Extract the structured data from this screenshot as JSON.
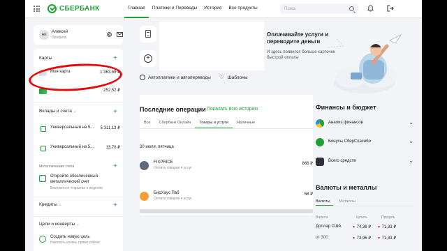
{
  "header": {
    "logo_text": "СБЕРБАНК",
    "nav": [
      "Главная",
      "Платежи и Переводы",
      "История",
      "Все продукты"
    ],
    "search_placeholder": "Поиск"
  },
  "profile": {
    "initials": "АК",
    "name": "Алексей",
    "subtitle": "Профиль"
  },
  "left": {
    "cards_head": "Карты",
    "cards": [
      {
        "label": "Моя карта",
        "sub": "··",
        "amount": "1 363,69 ₽"
      },
      {
        "label": "",
        "amount": "252,52 ₽"
      }
    ],
    "deposits_head": "Вклады и счета",
    "deposits": [
      {
        "label": "Универсальный на 5...",
        "amount": "5 311,13 ₽"
      },
      {
        "label": "Универсальный на 5...",
        "amount": "13,70 ₽"
      }
    ],
    "metal_head": "Металлические счета",
    "metal_promo": "Откройте обезличенный металлический счет",
    "metal_promo_sub": "Бесплатное открытие и ведение",
    "credits_head": "Кредиты",
    "goals_head": "Цели и конверты",
    "new_goal": "Создать новую цель",
    "new_goal_sub": "Накопить копить прямо сейчас"
  },
  "promo": {
    "title": "Оплачивайте услуги и переводите деньги",
    "desc": "И здесь появится больше карточек быстрой оплаты"
  },
  "links": {
    "autopay": "Автоплатежи и автопереводы",
    "templates": "Шаблоны"
  },
  "ops": {
    "title": "Последние операции",
    "show_all": "Показать всю историю",
    "tabs": [
      "Все",
      "Сбербанк Онлайн",
      "Товары и услуги",
      "Наличные"
    ],
    "date": "30 июля, пятница",
    "items": [
      {
        "name": "FIXPRICE",
        "sub": "Оплата товаров и услуг",
        "amount": "866 ₽"
      },
      {
        "name": "БирХаус Паб",
        "sub": "Оплата товаров и услуг",
        "amount": "58 ₽"
      }
    ]
  },
  "finance": {
    "title": "Финансы и бюджет",
    "items": [
      "Анализ финансов",
      "Бонусы СберСпасибо",
      "Всего средств"
    ]
  },
  "currency": {
    "title": "Валюты и металлы",
    "tabs": [
      "Валюты",
      "Металлы"
    ],
    "headers": [
      "Валюта",
      "Купить",
      "Продать"
    ],
    "rows": [
      {
        "name": "Доллар США",
        "buy": "74,36 ₽",
        "sell": "71,33 ₽",
        "buy_dir": "▼",
        "sell_dir": "▼"
      },
      {
        "name": "от 300",
        "buy": "73,96 ₽",
        "sell": "71,33 ₽",
        "buy_dir": "▼",
        "sell_dir": "▼"
      }
    ]
  },
  "colors": {
    "brand": "#21a038",
    "annotation": "#e50a0a"
  }
}
